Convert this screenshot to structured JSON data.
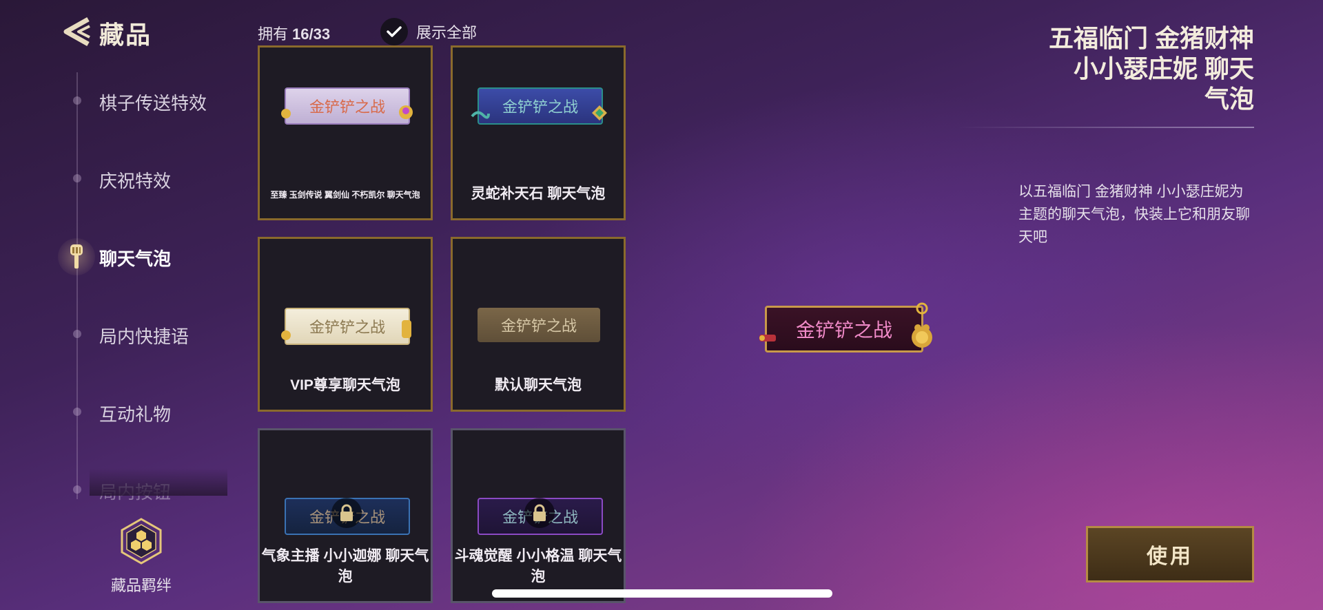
{
  "header": {
    "title": "藏品",
    "owned_label": "拥有",
    "owned_count": "16/33",
    "show_all_label": "展示全部"
  },
  "sidebar": {
    "items": [
      {
        "label": "棋子传送特效"
      },
      {
        "label": "庆祝特效"
      },
      {
        "label": "聊天气泡"
      },
      {
        "label": "局内快捷语"
      },
      {
        "label": "互动礼物"
      },
      {
        "label": "局内按钮"
      }
    ],
    "active_index": 2,
    "bonds_label": "藏品羁绊"
  },
  "grid": {
    "bubble_text": "金铲铲之战",
    "cards": [
      {
        "label": "至臻  玉剑传说  翼剑仙  不朽凯尔  聊天气泡",
        "style": "lavender",
        "locked": false
      },
      {
        "label": "灵蛇补天石  聊天气泡",
        "style": "blue",
        "locked": false
      },
      {
        "label": "VIP尊享聊天气泡",
        "style": "cream",
        "locked": false
      },
      {
        "label": "默认聊天气泡",
        "style": "brown",
        "locked": false
      },
      {
        "label": "气象主播  小小迦娜  聊天气泡",
        "style": "navy",
        "locked": true
      },
      {
        "label": "斗魂觉醒  小小格温  聊天气泡",
        "style": "purple",
        "locked": true
      }
    ]
  },
  "detail": {
    "title_line1": "五福临门  金猪财神",
    "title_line2": "小小瑟庄妮    聊天",
    "title_line3": "气泡",
    "description": "以五福临门 金猪财神 小小瑟庄妮为主题的聊天气泡，快装上它和朋友聊天吧",
    "preview_text": "金铲铲之战",
    "use_button": "使用"
  },
  "colors": {
    "gold_border": "#8a6a2c",
    "locked_border": "#59556a",
    "card_bg": "#1e1b24",
    "use_button_border": "#b58b43"
  }
}
